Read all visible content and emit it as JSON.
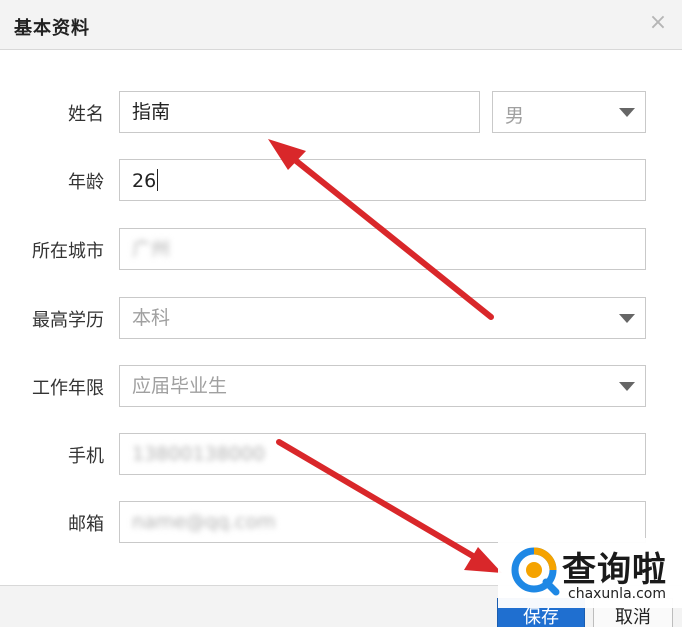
{
  "dialog": {
    "title": "基本资料",
    "close_glyph": "×"
  },
  "form": {
    "name": {
      "label": "姓名",
      "value": "指南"
    },
    "gender": {
      "value": "男"
    },
    "age": {
      "label": "年龄",
      "value": "26"
    },
    "city": {
      "label": "所在城市",
      "value": "广州"
    },
    "education": {
      "label": "最高学历",
      "value": "本科"
    },
    "experience": {
      "label": "工作年限",
      "value": "应届毕业生"
    },
    "phone": {
      "label": "手机",
      "value": "13800138000"
    },
    "email": {
      "label": "邮箱",
      "value": "name@qq.com"
    }
  },
  "footer": {
    "save_label": "保存",
    "cancel_label": "取消"
  },
  "watermark": {
    "name_cn": "查询啦",
    "domain": "chaxunla.com"
  },
  "colors": {
    "arrow": "#d9272a",
    "save_button": "#1f6fd0",
    "watermark_blue": "#1e88e5",
    "watermark_orange": "#f5a300"
  },
  "icons": [
    "close-icon",
    "chevron-down-icon",
    "magnifier-logo-icon"
  ]
}
